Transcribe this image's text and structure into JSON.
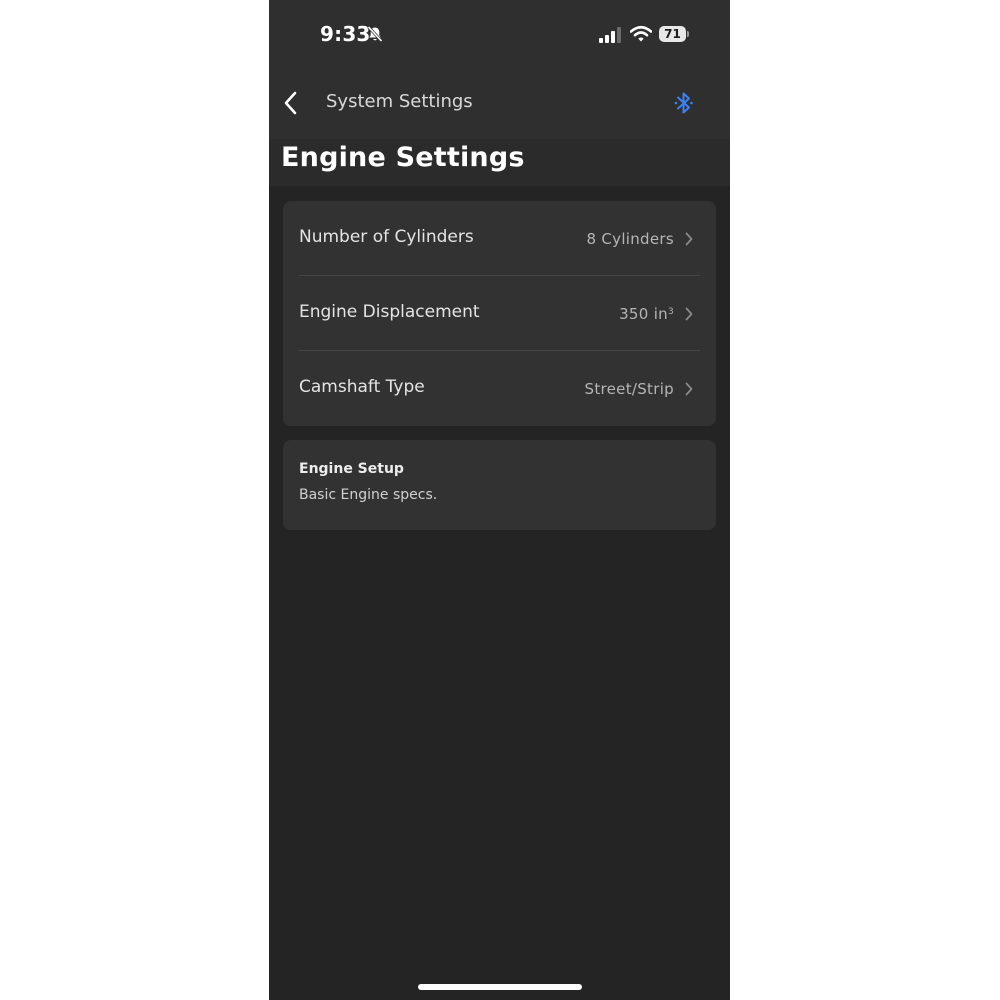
{
  "status_bar": {
    "time": "9:33",
    "battery_level": "71",
    "icons": [
      "bell-off-icon",
      "signal-icon",
      "wifi-icon",
      "battery-icon"
    ]
  },
  "nav": {
    "back_icon": "chevron-left-icon",
    "title": "System Settings",
    "bluetooth_icon": "bluetooth-icon",
    "bluetooth_color": "#3b82f6"
  },
  "page": {
    "title": "Engine Settings"
  },
  "settings": {
    "rows": [
      {
        "label": "Number of Cylinders",
        "value": "8 Cylinders"
      },
      {
        "label": "Engine Displacement",
        "value": "350 in",
        "value_superscript": "3"
      },
      {
        "label": "Camshaft Type",
        "value": "Street/Strip"
      }
    ]
  },
  "info": {
    "title": "Engine Setup",
    "text": "Basic Engine specs."
  },
  "colors": {
    "background": "#242424",
    "header": "#2f2f30",
    "card": "#323233",
    "accent": "#3b82f6"
  }
}
